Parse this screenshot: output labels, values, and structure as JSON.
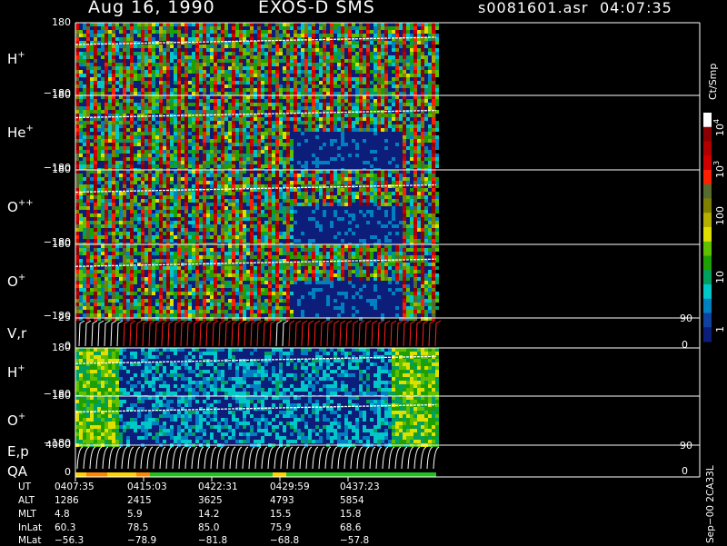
{
  "header": {
    "date": "Aug 16, 1990",
    "instrument": "EXOS-D SMS",
    "file": "s0081601.asr",
    "time": "04:07:35"
  },
  "panels": [
    {
      "label": "H",
      "sup": "+",
      "top_tick": "180",
      "bottom_tick": "−180"
    },
    {
      "label": "He",
      "sup": "+",
      "top_tick": "180",
      "bottom_tick": "−180"
    },
    {
      "label": "O",
      "sup": "++",
      "top_tick": "180",
      "bottom_tick": "−180"
    },
    {
      "label": "O",
      "sup": "+",
      "top_tick": "180",
      "bottom_tick": "−180"
    },
    {
      "label": "V,r",
      "sup": "",
      "top_tick": "25",
      "bottom_tick": "0",
      "right_top": "90",
      "right_bottom": "0"
    },
    {
      "label": "H",
      "sup": "+",
      "top_tick": "180",
      "bottom_tick": "−180"
    },
    {
      "label": "O",
      "sup": "+",
      "top_tick": "180",
      "bottom_tick": "−180"
    },
    {
      "label": "E,p",
      "sup": "",
      "top_tick": "4000",
      "bottom_tick": "0",
      "right_top": "90",
      "right_bottom": "0"
    }
  ],
  "qa_label": "QA",
  "colorbar": {
    "unit": "Ct/Smp",
    "ticks": [
      "10",
      "10",
      "100",
      "10",
      "1"
    ],
    "tick_sups": [
      "4",
      "3",
      "",
      "",
      ""
    ],
    "colors": [
      "#ffffff",
      "#8b0000",
      "#b00000",
      "#d00000",
      "#ff2000",
      "#556b2f",
      "#808000",
      "#b5b000",
      "#e0e000",
      "#60c000",
      "#20a000",
      "#00a060",
      "#00c8c8",
      "#0080c0",
      "#1040a0",
      "#0c1e7a"
    ]
  },
  "footer_code": "Sep−00  2CA33L",
  "ephemeris": {
    "labels": [
      "UT",
      "ALT",
      "MLT",
      "InLat",
      "MLat"
    ],
    "columns": [
      [
        "0407:35",
        "1286",
        "4.8",
        "60.3",
        "−56.3"
      ],
      [
        "0415:03",
        "2415",
        "5.9",
        "78.5",
        "−78.9"
      ],
      [
        "0422:31",
        "3625",
        "14.2",
        "85.0",
        "−81.8"
      ],
      [
        "0429:59",
        "4793",
        "15.5",
        "75.9",
        "−68.8"
      ],
      [
        "0437:23",
        "5854",
        "15.8",
        "68.6",
        "−57.8"
      ]
    ]
  },
  "chart_data": {
    "type": "heatmap",
    "title": "Aug 16, 1990   EXOS-D SMS",
    "xlabel": "UT",
    "x_ticks": [
      "0407:35",
      "0415:03",
      "0422:31",
      "0429:59",
      "0437:23"
    ],
    "y_range_angle": [
      -180,
      180
    ],
    "colorbar_scale": "log",
    "colorbar_range": [
      1,
      10000
    ],
    "series": [
      {
        "name": "H+",
        "ylim": [
          -180,
          180
        ]
      },
      {
        "name": "He+",
        "ylim": [
          -180,
          180
        ]
      },
      {
        "name": "O++",
        "ylim": [
          -180,
          180
        ]
      },
      {
        "name": "O+",
        "ylim": [
          -180,
          180
        ]
      },
      {
        "name": "V,r",
        "ylim": [
          0,
          25
        ]
      },
      {
        "name": "H+",
        "ylim": [
          -180,
          180
        ]
      },
      {
        "name": "O+",
        "ylim": [
          -180,
          180
        ]
      },
      {
        "name": "E,p",
        "ylim": [
          0,
          4000
        ]
      }
    ]
  }
}
